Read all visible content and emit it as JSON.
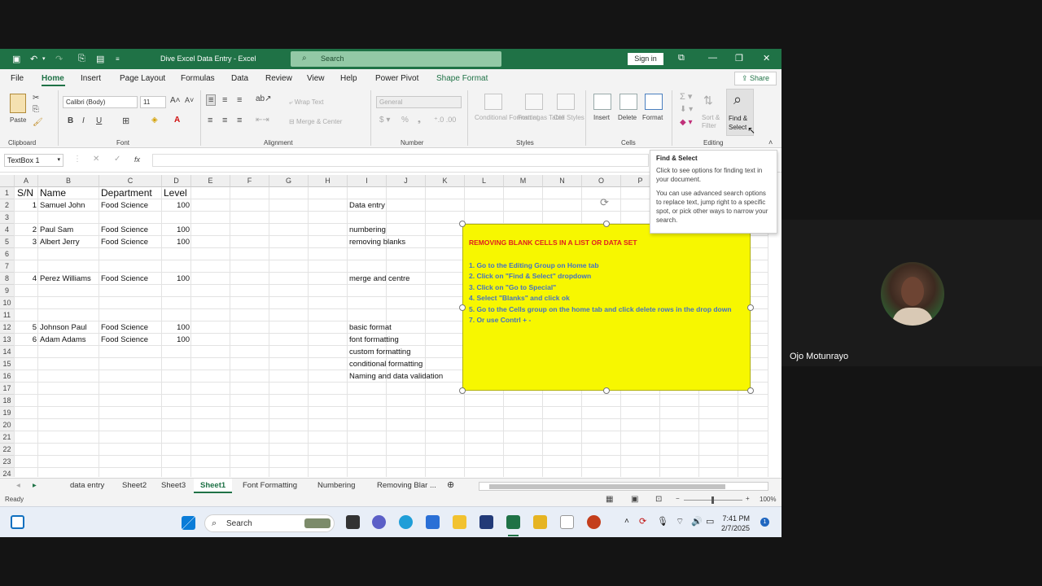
{
  "title_bar": {
    "doc_title": "Dive Excel Data Entry  -  Excel",
    "search_placeholder": "Search",
    "sign_in": "Sign in",
    "colors": {
      "excel_green": "#1f7246"
    }
  },
  "ribbon_tabs": [
    "File",
    "Home",
    "Insert",
    "Page Layout",
    "Formulas",
    "Data",
    "Review",
    "View",
    "Help",
    "Power Pivot",
    "Shape Format"
  ],
  "share_label": "Share",
  "ribbon": {
    "clipboard": {
      "paste": "Paste",
      "label": "Clipboard"
    },
    "font": {
      "name": "Calibri (Body)",
      "size": "11",
      "label": "Font"
    },
    "alignment": {
      "wrap": "Wrap Text",
      "merge": "Merge & Center",
      "label": "Alignment"
    },
    "number": {
      "format": "General",
      "label": "Number"
    },
    "styles": {
      "cond": "Conditional Formatting",
      "table": "Format as Table",
      "cell": "Cell Styles",
      "label": "Styles"
    },
    "cells": {
      "insert": "Insert",
      "delete": "Delete",
      "format": "Format",
      "label": "Cells"
    },
    "editing": {
      "sort": "Sort & Filter",
      "find": "Find & Select",
      "label": "Editing"
    }
  },
  "formula_bar": {
    "name_box": "TextBox 1",
    "fx": "fx"
  },
  "columns": [
    "A",
    "B",
    "C",
    "D",
    "E",
    "F",
    "G",
    "H",
    "I",
    "J",
    "K",
    "L",
    "M",
    "N",
    "O",
    "P"
  ],
  "rows": [
    "1",
    "2",
    "3",
    "4",
    "5",
    "6",
    "7",
    "8",
    "9",
    "10",
    "11",
    "12",
    "13",
    "14",
    "15",
    "16",
    "17",
    "18",
    "19",
    "20",
    "21",
    "22",
    "23",
    "24"
  ],
  "cells": {
    "header": {
      "sn": "S/N",
      "name": "Name",
      "dept": "Department",
      "level": "Level"
    },
    "data": [
      {
        "row": 2,
        "sn": "1",
        "name": "Samuel John",
        "dept": "Food Science",
        "level": "100"
      },
      {
        "row": 4,
        "sn": "2",
        "name": "Paul Sam",
        "dept": "Food Science",
        "level": "100"
      },
      {
        "row": 5,
        "sn": "3",
        "name": "Albert Jerry",
        "dept": "Food Science",
        "level": "100"
      },
      {
        "row": 8,
        "sn": "4",
        "name": "Perez Williams",
        "dept": "Food Science",
        "level": "100"
      },
      {
        "row": 12,
        "sn": "5",
        "name": "Johnson Paul",
        "dept": "Food Science",
        "level": "100"
      },
      {
        "row": 13,
        "sn": "6",
        "name": "Adam Adams",
        "dept": "Food Science",
        "level": "100"
      }
    ],
    "topics": [
      {
        "row": 2,
        "text": "Data entry"
      },
      {
        "row": 4,
        "text": "numbering"
      },
      {
        "row": 5,
        "text": "removing blanks"
      },
      {
        "row": 8,
        "text": "merge and centre"
      },
      {
        "row": 12,
        "text": "basic format"
      },
      {
        "row": 13,
        "text": "font formatting"
      },
      {
        "row": 14,
        "text": "custom formatting"
      },
      {
        "row": 15,
        "text": "conditional formatting"
      },
      {
        "row": 16,
        "text": "Naming and data validation"
      }
    ]
  },
  "textbox": {
    "title": "REMOVING BLANK CELLS IN A LIST OR DATA SET",
    "steps": [
      "1. Go to the Editing Group on Home tab",
      "2. Click on \"Find & Select\" dropdown",
      "3. Click on \"Go to Special\"",
      "4. Select \"Blanks\" and click ok",
      "5. Go to the Cells group on the home tab and click delete rows in the drop down",
      "7. Or use Contrl + -"
    ],
    "colors": {
      "fill": "#f7f700",
      "title": "#e02020",
      "body": "#4472c4"
    }
  },
  "tooltip": {
    "title": "Find & Select",
    "p1": "Click to see options for finding text in your document.",
    "p2": "You can use advanced search options to replace text, jump right to a specific spot, or pick other ways to narrow your search."
  },
  "sheet_tabs": [
    "data entry",
    "Sheet2",
    "Sheet3",
    "Sheet1",
    "Font Formatting",
    "Numbering",
    "Removing Blar ..."
  ],
  "active_sheet": "Sheet1",
  "status": {
    "ready": "Ready",
    "zoom": "100%"
  },
  "taskbar": {
    "search": "Search",
    "time": "7:41 PM",
    "date": "2/7/2025",
    "notif": "1"
  },
  "participant": {
    "name": "Ojo Motunrayo"
  }
}
